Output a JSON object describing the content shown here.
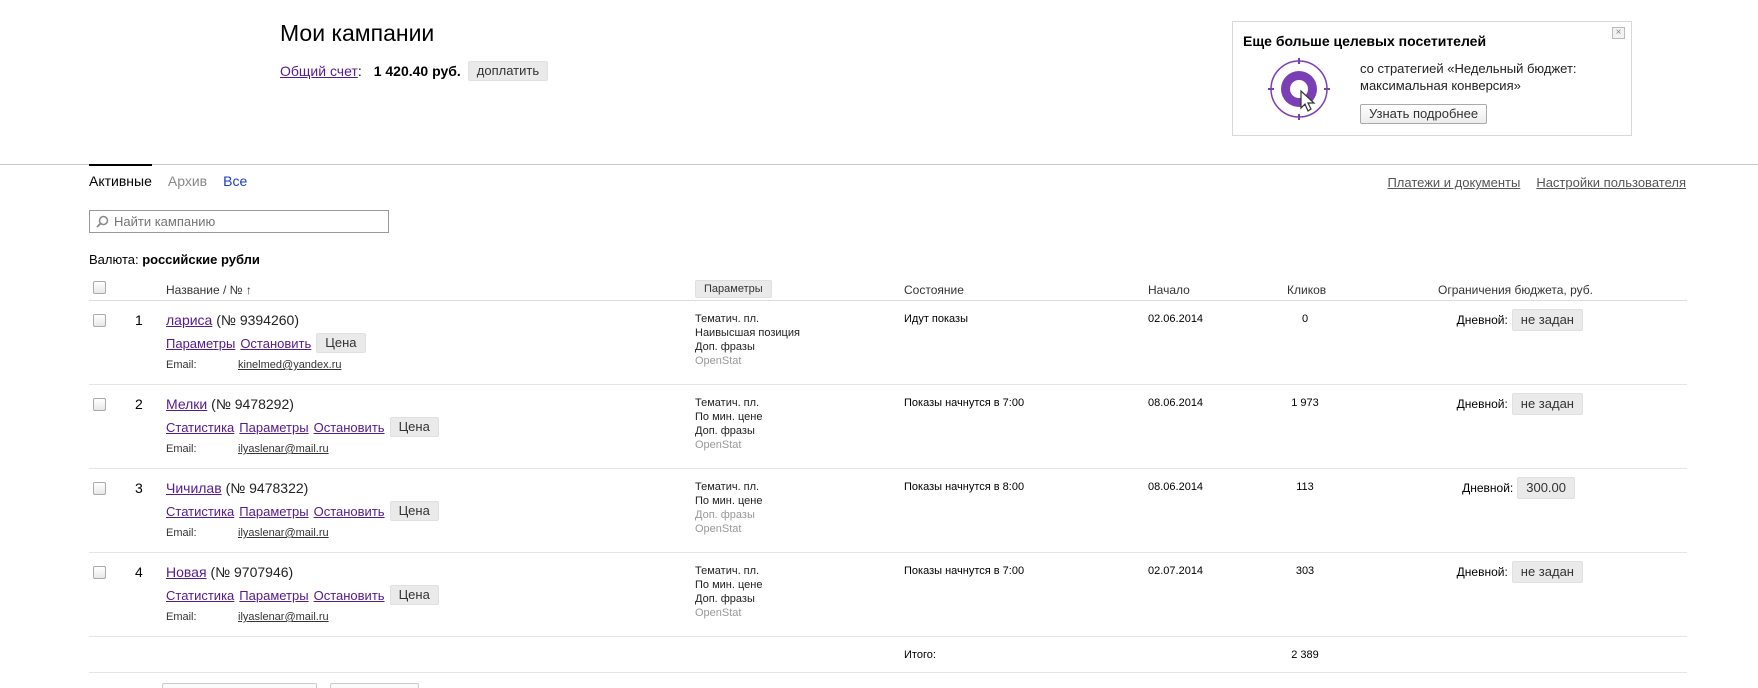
{
  "header": {
    "title": "Мои кампании",
    "account_link": "Общий счет",
    "account_colon": ":",
    "amount": "1 420.40 руб.",
    "topup_button": "доплатить"
  },
  "promo": {
    "title": "Еще больше целевых посетителей",
    "text": "со стратегией «Недельный бюджет: максимальная конверсия»",
    "button": "Узнать подробнее",
    "close": "×",
    "accent_color": "#7b3fb5"
  },
  "tabs": [
    {
      "label": "Активные",
      "active": true
    },
    {
      "label": "Архив",
      "active": false
    },
    {
      "label": "Все",
      "active": false
    }
  ],
  "links": {
    "payments": "Платежи и документы",
    "settings": "Настройки пользователя"
  },
  "search": {
    "placeholder": "Найти кампанию",
    "icon": "search-icon"
  },
  "currency": {
    "label": "Валюта:",
    "value": "российские рубли"
  },
  "table": {
    "headers": {
      "name": "Название / № ↑",
      "params": "Параметры",
      "state": "Состояние",
      "start": "Начало",
      "clicks": "Кликов",
      "budget": "Ограничения бюджета, руб."
    },
    "email_label": "Email:",
    "budget_label": "Дневной:",
    "links": {
      "stats": "Статистика",
      "params": "Параметры",
      "stop": "Остановить",
      "price": "Цена"
    },
    "rows": [
      {
        "num": "1",
        "name": "лариса",
        "id": "(№ 9394260)",
        "email": "kinelmed@yandex.ru",
        "p1": "Тематич. пл.",
        "p2": "Наивысшая позиция",
        "p3": "Доп. фразы",
        "p4": "OpenStat",
        "state": "Идут показы",
        "start": "02.06.2014",
        "clicks": "0",
        "budget": "не задан"
      },
      {
        "num": "2",
        "name": "Мелки",
        "id": "(№ 9478292)",
        "email": "ilyaslenar@mail.ru",
        "p1": "Тематич. пл.",
        "p2": "По мин. цене",
        "p3": "Доп. фразы",
        "p4": "OpenStat",
        "state": "Показы начнутся в 7:00",
        "start": "08.06.2014",
        "clicks": "1 973",
        "budget": "не задан"
      },
      {
        "num": "3",
        "name": "Чичилав",
        "id": "(№ 9478322)",
        "email": "ilyaslenar@mail.ru",
        "p1": "Тематич. пл.",
        "p2": "По мин. цене",
        "p3": "Доп. фразы",
        "p4": "OpenStat",
        "state": "Показы начнутся в 8:00",
        "start": "08.06.2014",
        "clicks": "113",
        "budget": "300.00"
      },
      {
        "num": "4",
        "name": "Новая",
        "id": "(№ 9707946)",
        "email": "ilyaslenar@mail.ru",
        "p1": "Тематич. пл.",
        "p2": "По мин. цене",
        "p3": "Доп. фразы",
        "p4": "OpenStat",
        "state": "Показы начнутся в 7:00",
        "start": "02.07.2014",
        "clicks": "303",
        "budget": "не задан"
      }
    ],
    "total_label": "Итого:",
    "total_clicks": "2 389"
  }
}
